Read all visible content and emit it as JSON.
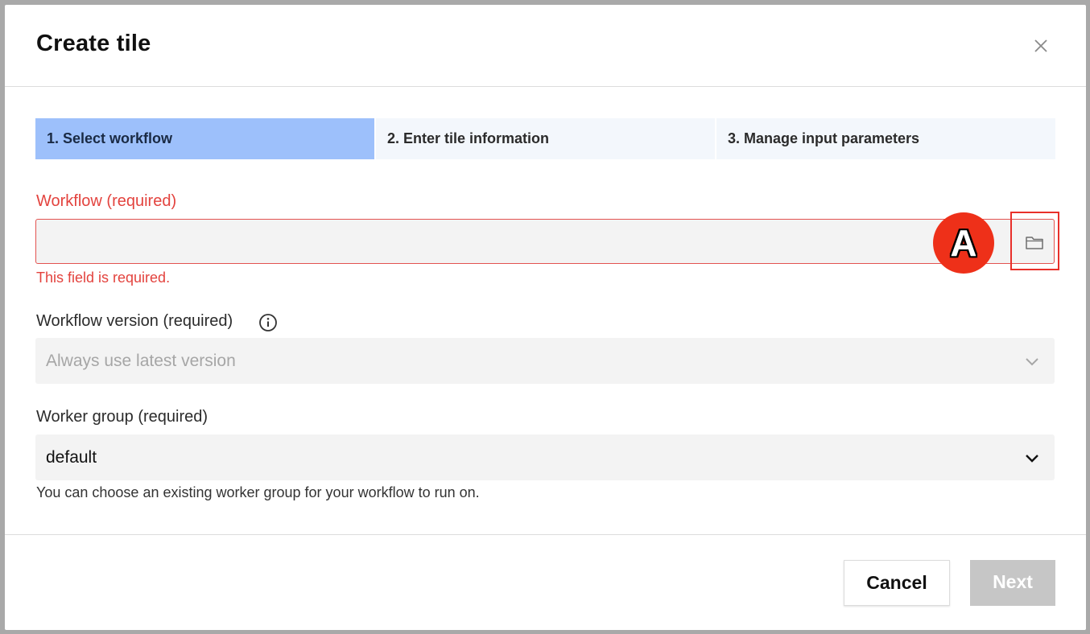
{
  "dialog": {
    "title": "Create tile",
    "close_icon": "close-icon"
  },
  "stepper": {
    "steps": [
      {
        "label": "1. Select workflow",
        "active": true
      },
      {
        "label": "2. Enter tile information",
        "active": false
      },
      {
        "label": "3. Manage input parameters",
        "active": false
      }
    ]
  },
  "workflow": {
    "label": "Workflow (required)",
    "value": "",
    "error": "This field is required.",
    "browse_icon": "folder-icon",
    "annotation_badge": "A"
  },
  "workflow_version": {
    "label": "Workflow version (required)",
    "info_icon": "info-icon",
    "value": "Always use latest version",
    "disabled": true
  },
  "worker_group": {
    "label": "Worker group (required)",
    "value": "default",
    "helper": "You can choose an existing worker group for your workflow to run on."
  },
  "footer": {
    "cancel_label": "Cancel",
    "next_label": "Next"
  },
  "colors": {
    "active_step": "#9dc0fb",
    "error": "#e3433e",
    "badge": "#ee3019",
    "disabled_button": "#c6c6c6"
  }
}
